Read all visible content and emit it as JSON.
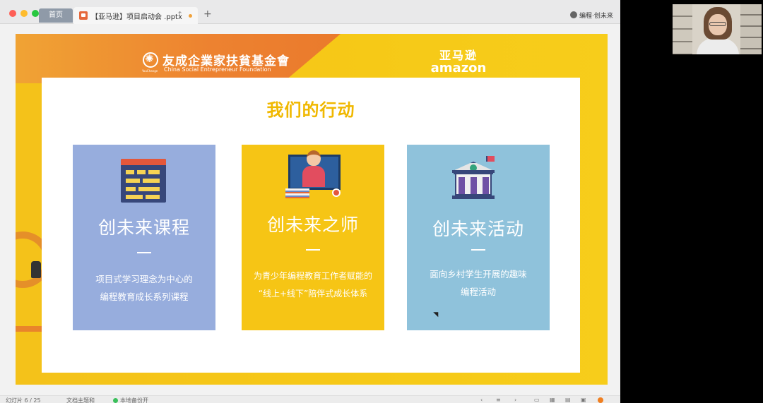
{
  "app": {
    "tabs": {
      "home_label": "首页",
      "file_label": "【亚马逊】项目启动会 .pptx"
    },
    "user_name": "编程·创未来",
    "status_bar": {
      "slide_counter": "幻灯片 6 / 25",
      "theme": "文档主题和",
      "backup": "本地备份开"
    }
  },
  "slide": {
    "foundation_cn": "友成企業家扶貧基金會",
    "foundation_en": "China Social Entrepreneur Foundation",
    "foundation_small": "YouChange",
    "amazon_cn": "亚马逊",
    "amazon_en": "amazon",
    "title": "我们的行动",
    "cards": [
      {
        "title": "创未来课程",
        "desc_line1": "项目式学习理念为中心的",
        "desc_line2": "编程教育成长系列课程"
      },
      {
        "title": "创未来之师",
        "desc_line1": "为青少年编程教育工作者赋能的",
        "desc_line2": "“线上+线下”陪伴式成长体系"
      },
      {
        "title": "创未来活动",
        "desc_line1": "面向乡村学生开展的趣味",
        "desc_line2": "编程活动"
      }
    ]
  },
  "colors": {
    "card_course": "#97addd",
    "card_teacher": "#f6c515",
    "card_activity": "#8fc2db",
    "title_accent": "#f0b800"
  },
  "icons": [
    "course-schedule-icon",
    "teacher-icon",
    "school-building-icon",
    "search-icon"
  ]
}
